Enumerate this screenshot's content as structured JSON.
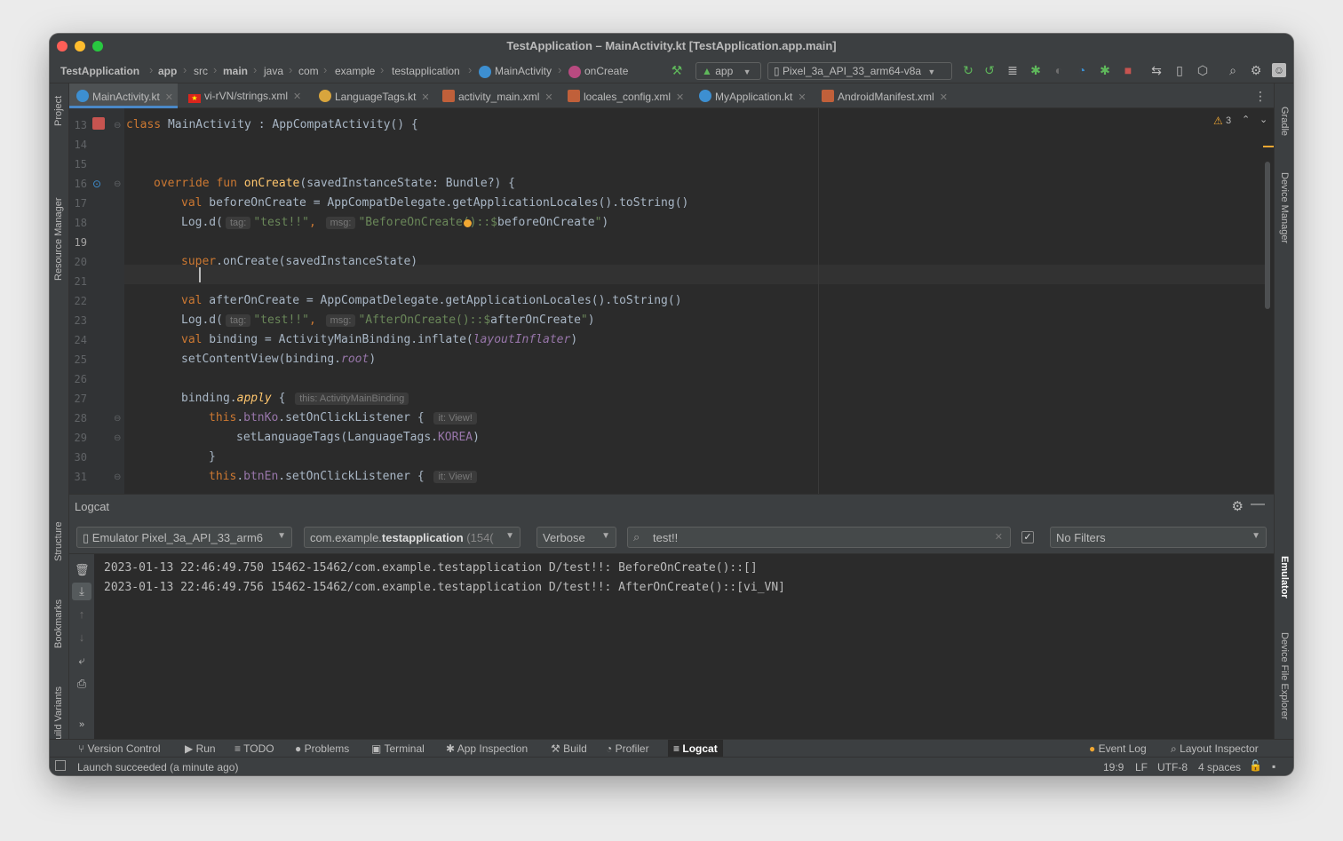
{
  "window": {
    "title": "TestApplication – MainActivity.kt [TestApplication.app.main]"
  },
  "breadcrumb": [
    "TestApplication",
    "app",
    "src",
    "main",
    "java",
    "com",
    "example",
    "testapplication",
    "MainActivity",
    "onCreate"
  ],
  "toolbar": {
    "run_config": "app",
    "device": "Pixel_3a_API_33_arm64-v8a"
  },
  "tabs": [
    {
      "label": "MainActivity.kt",
      "icon": "kotlin-class-icon"
    },
    {
      "label": "vi-rVN/strings.xml",
      "icon": "vietnam-flag-icon"
    },
    {
      "label": "LanguageTags.kt",
      "icon": "kotlin-object-icon"
    },
    {
      "label": "activity_main.xml",
      "icon": "layout-file-icon"
    },
    {
      "label": "locales_config.xml",
      "icon": "xml-file-icon"
    },
    {
      "label": "MyApplication.kt",
      "icon": "kotlin-class-icon"
    },
    {
      "label": "AndroidManifest.xml",
      "icon": "manifest-file-icon"
    }
  ],
  "side_left": [
    "Project",
    "Resource Manager",
    "Structure",
    "Bookmarks",
    "Build Variants"
  ],
  "side_right": [
    "Gradle",
    "Device Manager",
    "Emulator",
    "Device File Explorer"
  ],
  "editor": {
    "warnings": "3",
    "line_numbers": [
      "13",
      "14",
      "15",
      "16",
      "17",
      "18",
      "19",
      "20",
      "21",
      "22",
      "23",
      "24",
      "25",
      "26",
      "27",
      "28",
      "29",
      "30",
      "31"
    ],
    "current_line": "19"
  },
  "code": {
    "l13": {
      "kw": "class",
      "rest": " MainActivity : AppCompatActivity() {"
    },
    "l16": {
      "kw": "override fun ",
      "fn": "onCreate",
      "rest": "(savedInstanceState: Bundle?) {"
    },
    "l17": {
      "kw": "val",
      "rest": " beforeOnCreate = AppCompatDelegate.getApplicationLocales().toString()"
    },
    "l18": {
      "pre": "Log.d(",
      "hint_tag": "tag:",
      "str1": "\"test!!\"",
      "comma": ",",
      "hint_msg": "msg:",
      "str2": "\"BeforeOnCreate()::$",
      "var": "beforeOnCreate",
      "str3": "\"",
      "end": ")"
    },
    "l20": {
      "kw": "super",
      "rest": ".onCreate(savedInstanceState)"
    },
    "l22": {
      "kw": "val",
      "rest": " afterOnCreate = AppCompatDelegate.getApplicationLocales().toString()"
    },
    "l23": {
      "pre": "Log.d(",
      "hint_tag": "tag:",
      "str1": "\"test!!\"",
      "comma": ",",
      "hint_msg": "msg:",
      "str2": "\"AfterOnCreate()::$",
      "var": "afterOnCreate",
      "str3": "\"",
      "end": ")"
    },
    "l24": {
      "kw": "val",
      "rest": " binding = ActivityMainBinding.inflate(",
      "prop": "layoutInflater",
      "end": ")"
    },
    "l25": {
      "pre": "setContentView(binding.",
      "prop": "root",
      "end": ")"
    },
    "l27": {
      "pre": "binding.",
      "fn": "apply",
      "rest": " {",
      "hint": "this: ActivityMainBinding"
    },
    "l28": {
      "kw": "this",
      "dot": ".",
      "prop": "btnKo",
      "rest": ".setOnClickListener {",
      "hint": "it: View!"
    },
    "l29": {
      "pre": "setLanguageTags(LanguageTags.",
      "prop": "KOREA",
      "end": ")"
    },
    "l30": {
      "pre": "}"
    },
    "l31": {
      "kw": "this",
      "dot": ".",
      "prop": "btnEn",
      "rest": ".setOnClickListener {",
      "hint": "it: View!"
    }
  },
  "logcat": {
    "title": "Logcat",
    "device": "Emulator Pixel_3a_API_33_arm6",
    "package_prefix": "com.example.",
    "package_bold": "testapplication",
    "package_pid": " (154(",
    "level": "Verbose",
    "search": "test!!",
    "filter": "No Filters",
    "lines": [
      "2023-01-13 22:46:49.750 15462-15462/com.example.testapplication D/test!!: BeforeOnCreate()::[]",
      "2023-01-13 22:46:49.756 15462-15462/com.example.testapplication D/test!!: AfterOnCreate()::[vi_VN]"
    ]
  },
  "bottom_tools": [
    "Version Control",
    "Run",
    "TODO",
    "Problems",
    "Terminal",
    "App Inspection",
    "Build",
    "Profiler",
    "Logcat"
  ],
  "bottom_right": [
    "Event Log",
    "Layout Inspector"
  ],
  "status": {
    "message": "Launch succeeded (a minute ago)",
    "position": "19:9",
    "line_sep": "LF",
    "encoding": "UTF-8",
    "indent": "4 spaces"
  }
}
